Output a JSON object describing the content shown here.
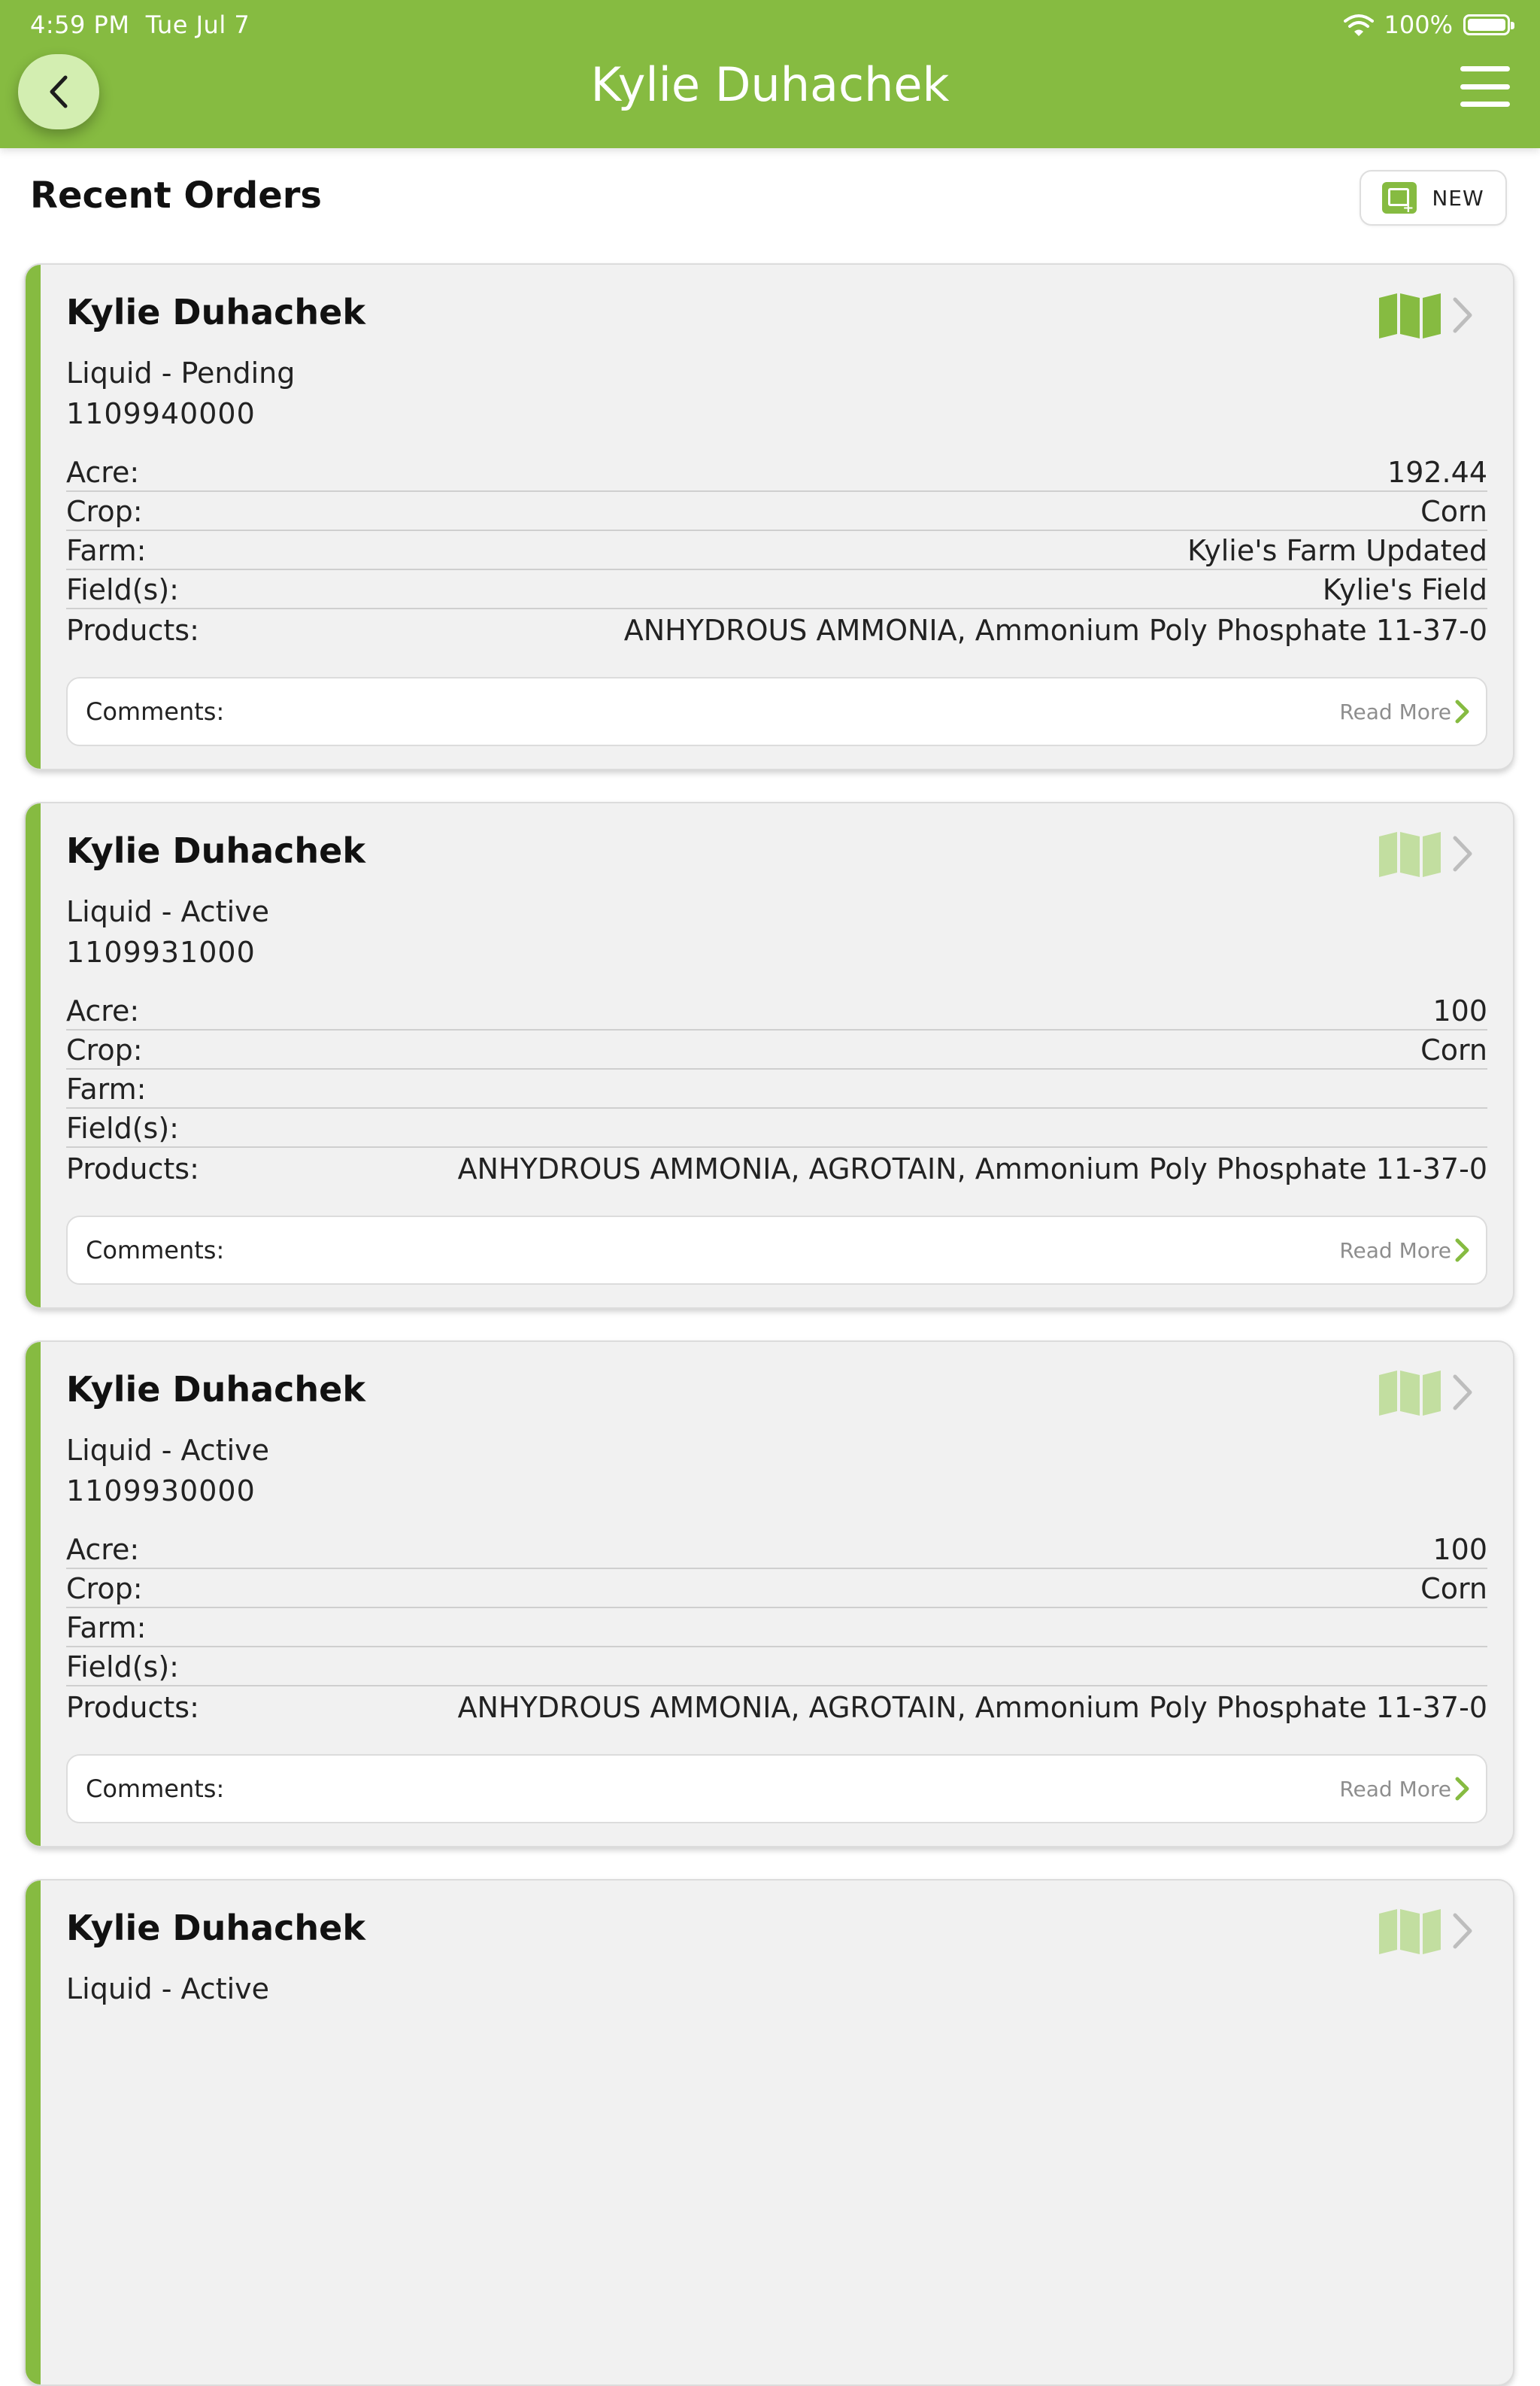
{
  "status_bar": {
    "time": "4:59 PM",
    "date": "Tue Jul 7",
    "battery": "100%"
  },
  "header": {
    "title": "Kylie Duhachek",
    "back_icon": "chevron-left-icon",
    "menu_icon": "hamburger-menu-icon"
  },
  "section": {
    "title": "Recent Orders",
    "new_label": "NEW"
  },
  "labels": {
    "acre": "Acre:",
    "crop": "Crop:",
    "farm": "Farm:",
    "fields": "Field(s):",
    "products": "Products:",
    "comments": "Comments:",
    "read_more": "Read More"
  },
  "colors": {
    "brand_green": "#86bb41",
    "map_active": "#86bb41",
    "map_inactive": "#c2dea0"
  },
  "orders": [
    {
      "name": "Kylie Duhachek",
      "status": "Liquid - Pending",
      "number": "1109940000",
      "acre": "192.44",
      "crop": "Corn",
      "farm": "Kylie's Farm Updated",
      "fields": "Kylie's Field",
      "products": "ANHYDROUS AMMONIA, Ammonium Poly Phosphate 11-37-0",
      "map_active": true
    },
    {
      "name": "Kylie Duhachek",
      "status": "Liquid - Active",
      "number": "1109931000",
      "acre": "100",
      "crop": "Corn",
      "farm": "",
      "fields": "",
      "products": "ANHYDROUS AMMONIA, AGROTAIN, Ammonium Poly Phosphate 11-37-0",
      "map_active": false
    },
    {
      "name": "Kylie Duhachek",
      "status": "Liquid - Active",
      "number": "1109930000",
      "acre": "100",
      "crop": "Corn",
      "farm": "",
      "fields": "",
      "products": "ANHYDROUS AMMONIA, AGROTAIN, Ammonium Poly Phosphate 11-37-0",
      "map_active": false
    },
    {
      "name": "Kylie Duhachek",
      "status": "Liquid - Active",
      "map_active": false
    }
  ]
}
